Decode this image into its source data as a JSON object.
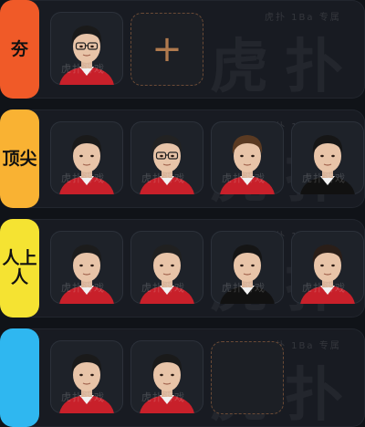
{
  "watermark": {
    "big": "虎扑",
    "small": "虎扑 1Ba  专属",
    "card": "虎扑游戏"
  },
  "tiers": [
    {
      "label": "夯",
      "color": "#f05a28",
      "players": [
        {
          "jersey": "#c8202a",
          "hair": "#1a1a1a",
          "glasses": true
        }
      ],
      "add_slot_label": "+"
    },
    {
      "label": "顶尖",
      "color": "#f9b233",
      "players": [
        {
          "jersey": "#c8202a",
          "hair": "#1a1a1a",
          "glasses": false
        },
        {
          "jersey": "#c8202a",
          "hair": "#222222",
          "glasses": true
        },
        {
          "jersey": "#c8202a",
          "hair": "#5a3a22",
          "glasses": false
        },
        {
          "jersey": "#111111",
          "hair": "#161616",
          "glasses": false
        }
      ]
    },
    {
      "label": "人上\n人",
      "color": "#f5e332",
      "players": [
        {
          "jersey": "#c8202a",
          "hair": "#1c1c1c",
          "glasses": false
        },
        {
          "jersey": "#c8202a",
          "hair": "#202020",
          "glasses": false
        },
        {
          "jersey": "#111111",
          "hair": "#151515",
          "glasses": false
        },
        {
          "jersey": "#c8202a",
          "hair": "#2a1e18",
          "glasses": false
        }
      ]
    },
    {
      "label": "",
      "color": "#2fb7f0",
      "players": [
        {
          "jersey": "#c8202a",
          "hair": "#1a1a1a",
          "glasses": false
        },
        {
          "jersey": "#c8202a",
          "hair": "#1a1a1a",
          "glasses": false
        }
      ],
      "add_slot_label": ""
    }
  ],
  "icons": {
    "add": "plus-icon",
    "avatar": "player-avatar"
  }
}
